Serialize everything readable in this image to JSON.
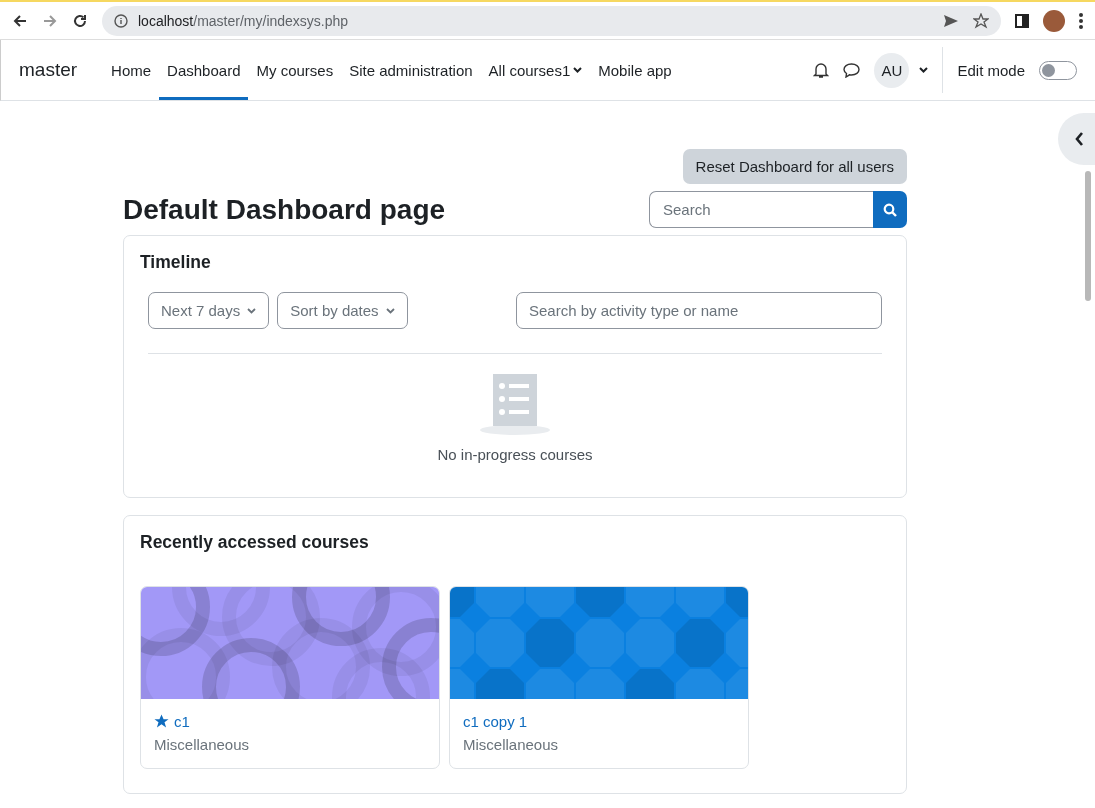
{
  "browser": {
    "url_host": "localhost",
    "url_path": "/master/my/indexsys.php"
  },
  "navbar": {
    "brand": "master",
    "items": [
      {
        "label": "Home",
        "selected": false,
        "dropdown": false
      },
      {
        "label": "Dashboard",
        "selected": true,
        "dropdown": false
      },
      {
        "label": "My courses",
        "selected": false,
        "dropdown": false
      },
      {
        "label": "Site administration",
        "selected": false,
        "dropdown": false
      },
      {
        "label": "All courses1",
        "selected": false,
        "dropdown": true
      },
      {
        "label": "Mobile app",
        "selected": false,
        "dropdown": false
      }
    ],
    "avatar": "AU",
    "edit_mode": {
      "label": "Edit mode",
      "on": false
    }
  },
  "page": {
    "reset_button": "Reset Dashboard for all users",
    "title": "Default Dashboard page",
    "search": {
      "placeholder": "Search"
    }
  },
  "timeline": {
    "title": "Timeline",
    "filters": [
      "Next 7 days",
      "Sort by dates"
    ],
    "search": {
      "placeholder": "Search by activity type or name"
    },
    "empty_text": "No in-progress courses"
  },
  "recent": {
    "title": "Recently accessed courses",
    "courses": [
      {
        "name": "c1",
        "category": "Miscellaneous",
        "starred": true,
        "kind": "circles",
        "color": "#a298f7"
      },
      {
        "name": "c1 copy 1",
        "category": "Miscellaneous",
        "starred": false,
        "kind": "octagons",
        "color": "#0a80e0"
      }
    ]
  }
}
